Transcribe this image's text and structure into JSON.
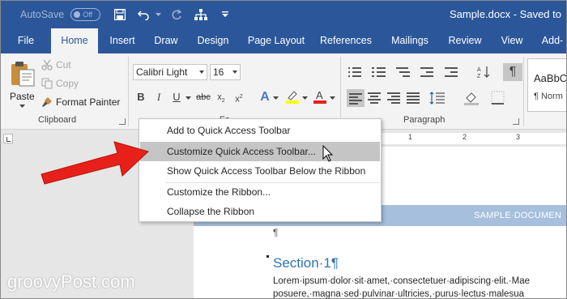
{
  "titlebar": {
    "autosave_label": "AutoSave",
    "autosave_toggle": "Off",
    "title": "Sample.docx  -  Saved to",
    "bg_color": "#2b579a"
  },
  "tabs": [
    "File",
    "Home",
    "Insert",
    "Draw",
    "Design",
    "Page Layout",
    "References",
    "Mailings",
    "Review",
    "View",
    "Add-"
  ],
  "ribbon": {
    "clipboard": {
      "paste": "Paste",
      "cut": "Cut",
      "copy": "Copy",
      "format_painter": "Format Painter",
      "group_label": "Clipboard"
    },
    "font": {
      "font_name": "Calibri Light",
      "font_size": "16",
      "group_label": "Fo"
    },
    "paragraph": {
      "group_label": "Paragraph"
    },
    "styles": {
      "sample": "AaBbC",
      "name": "¶ Norm"
    }
  },
  "ruler": {
    "numbers": [
      "1",
      "2",
      "3"
    ]
  },
  "context_menu": {
    "items": [
      {
        "label": "Add to Quick Access Toolbar",
        "enabled": true,
        "hovered": false
      },
      {
        "label": "Customize Quick Access Toolbar...",
        "enabled": true,
        "hovered": true
      },
      {
        "label": "Show Quick Access Toolbar Below the Ribbon",
        "enabled": true,
        "hovered": false
      },
      {
        "label": "Customize the Ribbon...",
        "enabled": true,
        "hovered": false
      },
      {
        "label": "Collapse the Ribbon",
        "enabled": true,
        "hovered": false
      }
    ]
  },
  "document": {
    "header_text": "SAMPLE·DOCUMEN",
    "pilcrow": "¶",
    "section_heading": "Section·1¶",
    "body_lines": [
      "Lorem·ipsum·dolor·sit·amet,·consectetuer·adipiscing·elit.·Mae",
      "posuere,·magna·sed·pulvinar·ultricies,·purus·lectus·malesua"
    ]
  },
  "watermark": "groovyPost.com",
  "colors": {
    "accent": "#2b579a",
    "arrow": "#e8201a",
    "heading": "#2e74b5",
    "header_band": "#a5bfdc"
  }
}
